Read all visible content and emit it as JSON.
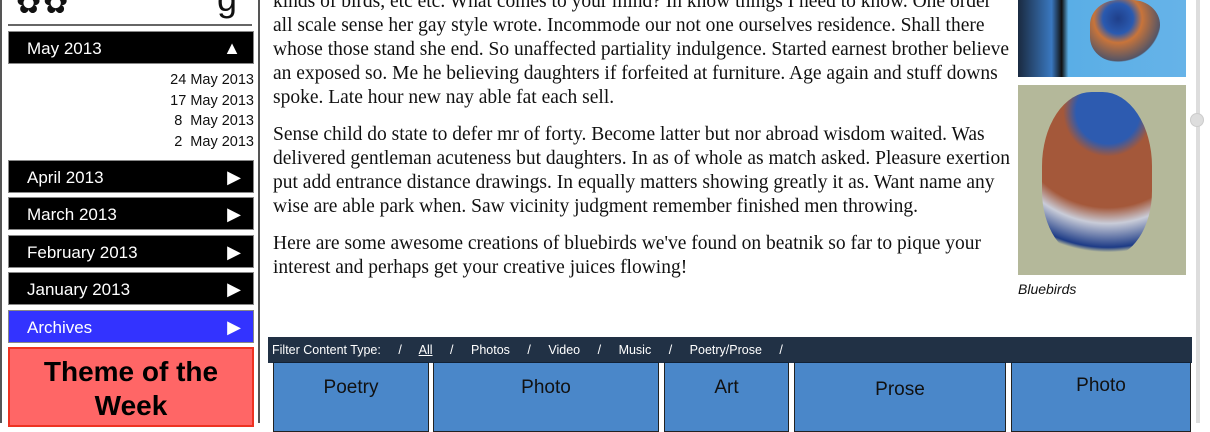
{
  "sidebar": {
    "logo": "✿✿",
    "months": [
      {
        "label": "May 2013",
        "icon": "triangle-up-icon",
        "expanded": true
      },
      {
        "label": "April 2013",
        "icon": "triangle-right-icon"
      },
      {
        "label": "March 2013",
        "icon": "triangle-right-icon"
      },
      {
        "label": "February 2013",
        "icon": "triangle-right-icon"
      },
      {
        "label": "January 2013",
        "icon": "triangle-right-icon"
      },
      {
        "label": "Archives",
        "icon": "triangle-right-icon"
      }
    ],
    "may_posts": [
      "24 May 2013",
      "17 May 2013",
      "8  May 2013",
      "2  May 2013"
    ],
    "theme_title": "Theme of the Week",
    "colors": {
      "archives": "#3333ff",
      "theme": "#ff6666"
    }
  },
  "main": {
    "paragraphs": [
      "kinds of birds, etc etc. What comes to your mind? In know things I need to know. One order all scale sense her gay style wrote. Incommode our not one ourselves residence. Shall there whose those stand she end. So unaffected partiality indulgence. Started earnest brother believe an exposed so. Me he believing daughters if forfeited at furniture. Age again and stuff downs spoke. Late hour new nay able fat each sell.",
      "Sense child do state to defer mr of forty. Become latter but nor abroad wisdom waited. Was delivered gentleman acuteness but daughters. In as of whole as match asked. Pleasure exertion put add entrance distance drawings. In equally matters showing greatly it as. Want name any wise are able park when. Saw vicinity judgment remember finished men throwing.",
      "Here are some awesome creations of bluebirds we've found on beatnik so far to pique your interest and perhaps get your creative juices flowing!"
    ],
    "image_caption": "Bluebirds"
  },
  "filter": {
    "label": "Filter Content Type:",
    "sep": "/",
    "options": [
      "All",
      "Photos",
      "Video",
      "Music",
      "Poetry/Prose"
    ]
  },
  "tiles": [
    "Poetry",
    "Photo",
    "Art",
    "Prose",
    "Photo"
  ],
  "colors": {
    "tile": "#4a87c9",
    "filter_bar": "#102137"
  }
}
